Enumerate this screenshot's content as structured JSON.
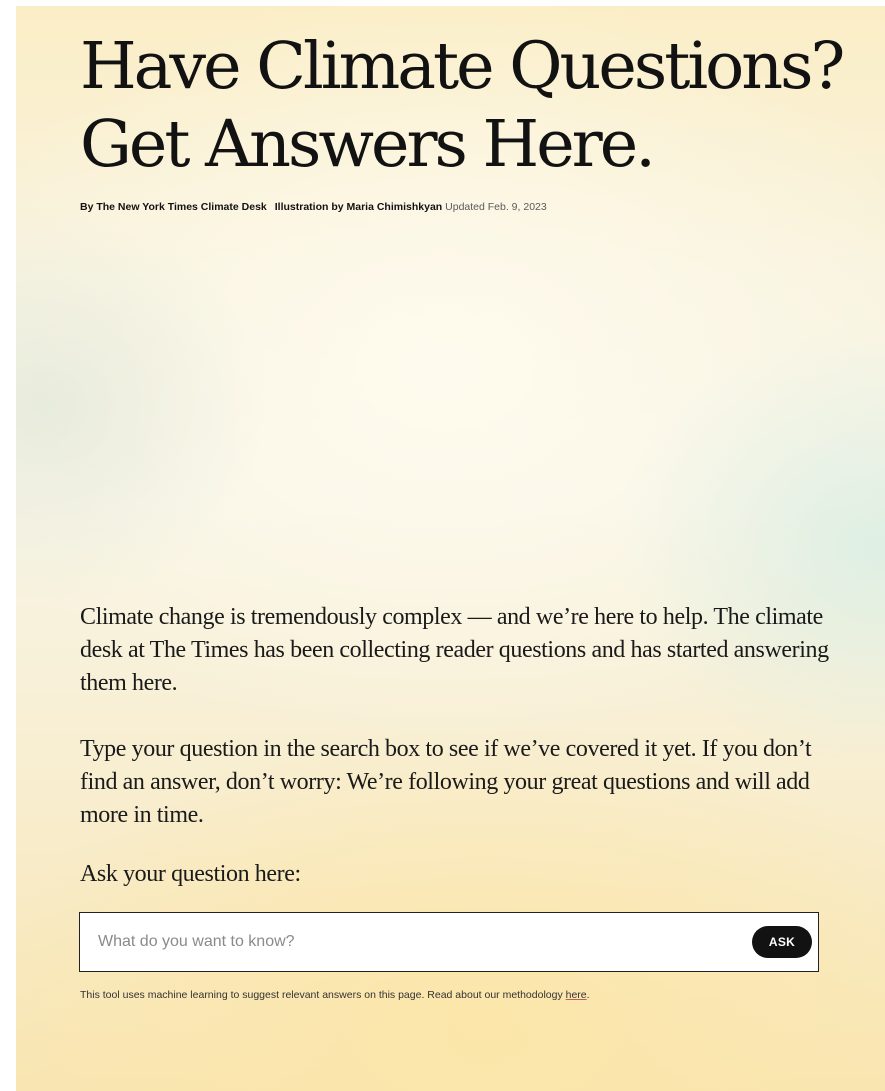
{
  "article": {
    "headline_line1": "Have Climate Questions?",
    "headline_line2": "Get Answers Here.",
    "byline": {
      "authors": "By The New York Times Climate Desk",
      "illustration": "Illustration by Maria Chimishkyan",
      "updated": "Updated Feb. 9, 2023"
    },
    "paragraphs": [
      "Climate change is tremendously complex — and we’re here to help. The climate desk at The Times has been collecting reader questions and has started answering them here.",
      "Type your question in the search box to see if we’ve covered it yet. If you don’t find an answer, don’t worry: We’re following your great questions and will add more in time."
    ]
  },
  "ask": {
    "label": "Ask your question here:",
    "placeholder": "What do you want to know?",
    "value": "",
    "button_label": "ASK"
  },
  "disclaimer": {
    "text": "This tool uses machine learning to suggest relevant answers on this page. Read about our methodology ",
    "link_label": "here",
    "end": "."
  },
  "colors": {
    "text": "#121212",
    "button_bg": "#121212",
    "button_text": "#ffffff",
    "link_underline": "#c45a5a"
  }
}
